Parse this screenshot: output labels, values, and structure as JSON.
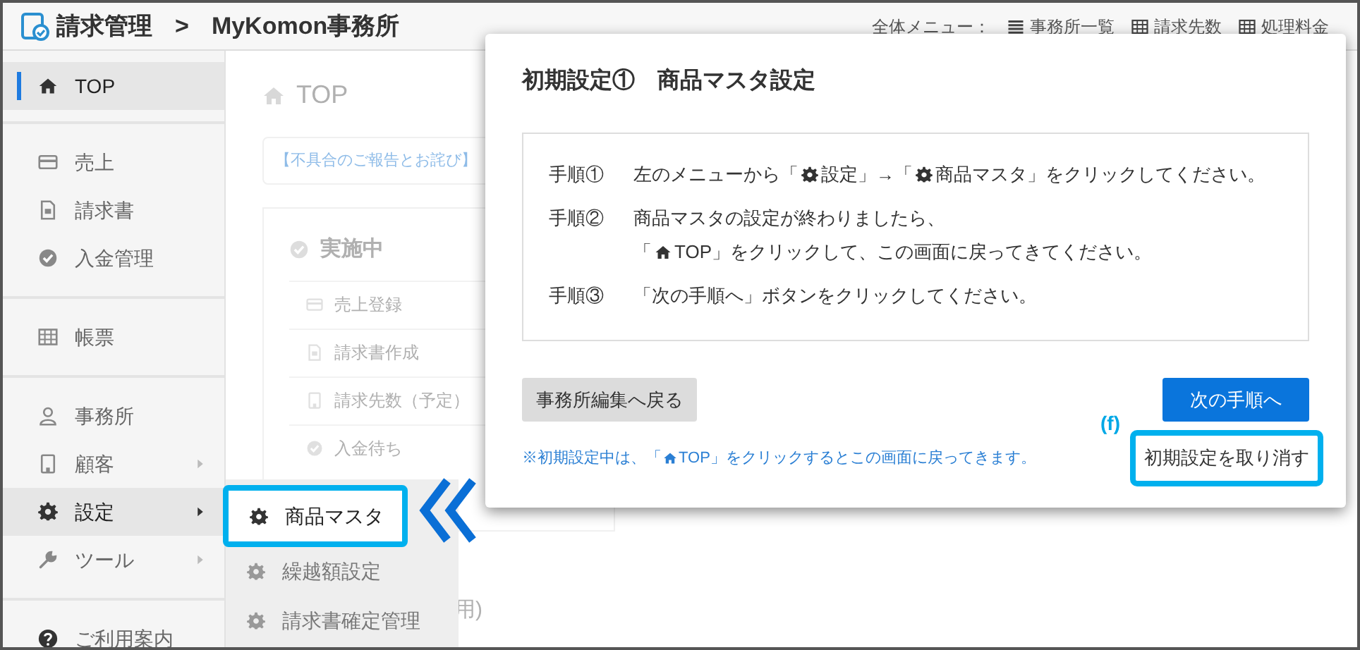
{
  "header": {
    "app": "請求管理",
    "separator": ">",
    "office": "MyKomon事務所",
    "menu_label": "全体メニュー：",
    "menu_links": [
      {
        "kind": "list",
        "label": "事務所一覧"
      },
      {
        "kind": "grid",
        "label": "請求先数"
      },
      {
        "kind": "grid",
        "label": "処理料金"
      }
    ]
  },
  "sidebar": {
    "groups": [
      [
        {
          "kind": "home",
          "label": "TOP",
          "selected": true,
          "submenu": false
        }
      ],
      [
        {
          "kind": "card",
          "label": "売上",
          "selected": false,
          "submenu": false
        },
        {
          "kind": "doc",
          "label": "請求書",
          "selected": false,
          "submenu": false
        },
        {
          "kind": "check",
          "label": "入金管理",
          "selected": false,
          "submenu": false
        }
      ],
      [
        {
          "kind": "grid",
          "label": "帳票",
          "selected": false,
          "submenu": false
        }
      ],
      [
        {
          "kind": "user",
          "label": "事務所",
          "selected": false,
          "submenu": false
        },
        {
          "kind": "building",
          "label": "顧客",
          "selected": false,
          "submenu": true
        },
        {
          "kind": "gear",
          "label": "設定",
          "selected": true,
          "submenu": true
        },
        {
          "kind": "wrench",
          "label": "ツール",
          "selected": false,
          "submenu": true
        }
      ],
      [
        {
          "kind": "help",
          "label": "ご利用案内",
          "selected": false,
          "submenu": false
        }
      ]
    ]
  },
  "submenu": [
    {
      "label": "商品マスタ",
      "highlighted": true
    },
    {
      "label": "繰越額設定",
      "highlighted": false
    },
    {
      "label": "請求書確定管理",
      "highlighted": false
    }
  ],
  "background": {
    "title": "TOP",
    "notice": "【不具合のご報告とお詫び】 ",
    "card_title": "実施中",
    "card_items": [
      {
        "kind": "card",
        "label": "売上登録"
      },
      {
        "kind": "doc",
        "label": "請求書作成"
      },
      {
        "kind": "building",
        "label": "請求先数（予定）"
      },
      {
        "kind": "check",
        "label": "入金待ち"
      }
    ],
    "footer_fragment": "用)"
  },
  "dialog": {
    "title": "初期設定①　商品マスタ設定",
    "steps": [
      {
        "label": "手順①",
        "lines": [
          [
            {
              "kind": "text",
              "text": "左のメニューから「"
            },
            {
              "kind": "gear"
            },
            {
              "kind": "text",
              "text": " 設定」→「"
            },
            {
              "kind": "gear"
            },
            {
              "kind": "text",
              "text": " 商品マスタ」をクリックしてください。"
            }
          ]
        ]
      },
      {
        "label": "手順②",
        "lines": [
          [
            {
              "kind": "text",
              "text": "商品マスタの設定が終わりましたら、"
            }
          ],
          [
            {
              "kind": "text",
              "text": "「"
            },
            {
              "kind": "home"
            },
            {
              "kind": "text",
              "text": " TOP」をクリックして、この画面に戻ってきてください。"
            }
          ]
        ]
      },
      {
        "label": "手順③",
        "lines": [
          [
            {
              "kind": "text",
              "text": "「次の手順へ」ボタンをクリックしてください。"
            }
          ]
        ]
      }
    ],
    "back_button": "事務所編集へ戻る",
    "next_button": "次の手順へ",
    "note": [
      {
        "kind": "text",
        "text": "※初期設定中は、「"
      },
      {
        "kind": "home"
      },
      {
        "kind": "text",
        "text": " TOP」をクリックするとこの画面に戻ってきます。"
      }
    ],
    "cancel_link": "初期設定を取り消す",
    "cancel_highlighted": true
  },
  "annotation": {
    "label": "(f)"
  }
}
